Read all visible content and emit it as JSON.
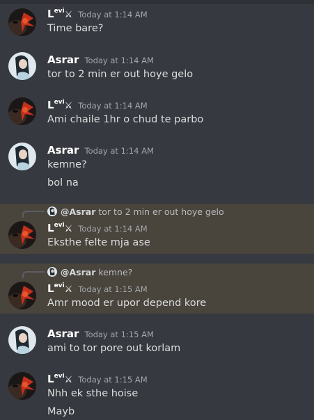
{
  "users": {
    "levi": {
      "name_main": "L",
      "name_sup": "evi",
      "name_suffix": "⚔"
    },
    "asrar": {
      "name": "Asrar"
    }
  },
  "messages": [
    {
      "author": "levi",
      "time": "Today at 1:14 AM",
      "lines": [
        "Time bare?"
      ]
    },
    {
      "author": "asrar",
      "time": "Today at 1:14 AM",
      "lines": [
        "tor to 2 min er out hoye gelo"
      ]
    },
    {
      "author": "levi",
      "time": "Today at 1:14 AM",
      "lines": [
        "Ami chaile 1hr o chud te parbo"
      ]
    },
    {
      "author": "asrar",
      "time": "Today at 1:14 AM",
      "lines": [
        "kemne?",
        "bol na"
      ]
    },
    {
      "author": "levi",
      "time": "Today at 1:14 AM",
      "lines": [
        "Eksthe felte mja ase"
      ],
      "reply": {
        "mention": "@Asrar",
        "text": "tor to 2 min er out hoye gelo"
      }
    },
    {
      "author": "levi",
      "time": "Today at 1:15 AM",
      "lines": [
        "Amr mood er upor depend kore"
      ],
      "reply": {
        "mention": "@Asrar",
        "text": "kemne?"
      }
    },
    {
      "author": "asrar",
      "time": "Today at 1:15 AM",
      "lines": [
        "ami to tor pore out korlam"
      ]
    },
    {
      "author": "levi",
      "time": "Today at 1:15 AM",
      "lines": [
        "Nhh ek sthe hoise",
        "Mayb"
      ]
    }
  ],
  "colors": {
    "background": "#36393f",
    "highlight": "#49443c",
    "username": "#ffffff",
    "timestamp": "#a3a6aa",
    "text": "#dcddde"
  },
  "icons": {
    "levi_avatar": "dark-red-flower-avatar-icon",
    "asrar_avatar": "girl-portrait-avatar-icon"
  }
}
